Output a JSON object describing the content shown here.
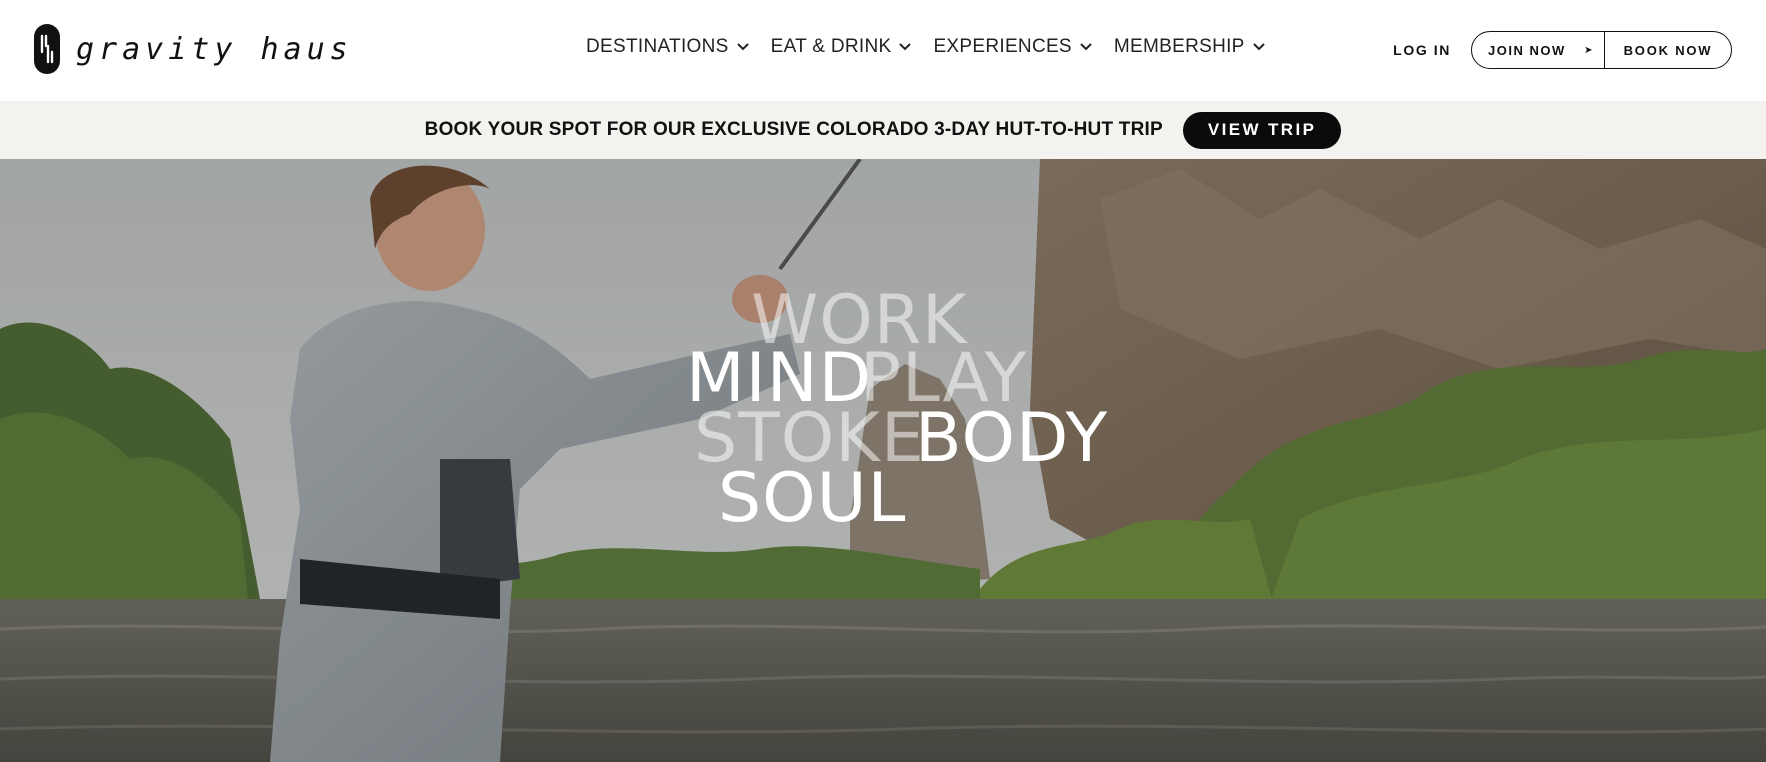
{
  "brand": {
    "name": "gravity haus",
    "logo_icon": "gravity-haus-mark"
  },
  "nav": {
    "items": [
      {
        "label": "DESTINATIONS",
        "icon": "chevron-down-icon"
      },
      {
        "label": "EAT & DRINK",
        "icon": "chevron-down-icon"
      },
      {
        "label": "EXPERIENCES",
        "icon": "chevron-down-icon"
      },
      {
        "label": "MEMBERSHIP",
        "icon": "chevron-down-icon"
      }
    ]
  },
  "header_actions": {
    "login": "LOG IN",
    "join": "JOIN NOW",
    "join_arrow": "➤",
    "book": "BOOK NOW"
  },
  "announcement": {
    "text": "BOOK YOUR SPOT FOR OUR EXCLUSIVE COLORADO 3-DAY HUT-TO-HUT TRIP",
    "button": "VIEW TRIP"
  },
  "hero": {
    "words": {
      "work": "WORK",
      "mind": "MIND",
      "play": "PLAY",
      "stoke": "STOKE",
      "body": "BODY",
      "soul": "SOUL"
    }
  },
  "colors": {
    "announcement_bg": "#f4f2ee",
    "button_dark": "#0b0b0b",
    "text": "#111111"
  }
}
